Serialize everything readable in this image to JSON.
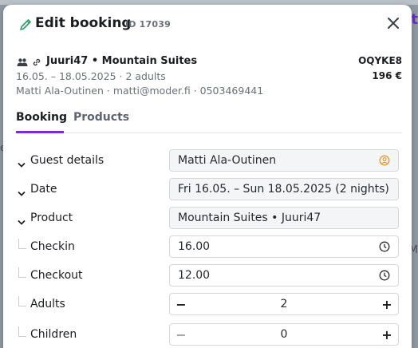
{
  "modal": {
    "title": "Edit booking",
    "id_label": "ID 17039"
  },
  "summary": {
    "title": "Juuri47 • Mountain Suites",
    "code": "OQYKE8",
    "dates": "16.05. – 18.05.2025 · 2 adults",
    "price": "196 €",
    "contact": "Matti Ala-Outinen · matti@moder.fi · 0503469441"
  },
  "tabs": [
    {
      "label": "Booking",
      "active": true
    },
    {
      "label": "Products",
      "active": false
    }
  ],
  "form": {
    "guest": {
      "label": "Guest details",
      "value": "Matti Ala-Outinen"
    },
    "date": {
      "label": "Date",
      "value": "Fri 16.05. – Sun 18.05.2025 (2 nights)"
    },
    "product": {
      "label": "Product",
      "value": "Mountain Suites • Juuri47"
    },
    "checkin": {
      "label": "Checkin",
      "value": "16.00"
    },
    "checkout": {
      "label": "Checkout",
      "value": "12.00"
    },
    "adults": {
      "label": "Adults",
      "value": "2",
      "minus": "−",
      "plus": "+"
    },
    "children": {
      "label": "Children",
      "value": "0",
      "minus": "−",
      "plus": "+"
    }
  },
  "icons": {
    "edit": "pencil-icon",
    "close": "close-icon",
    "people": "people-icon",
    "link": "link-icon",
    "chevron": "chevron-down-icon",
    "user": "user-circle-icon",
    "clock": "clock-icon"
  },
  "colors": {
    "accent": "#7c2bd6",
    "edit_icon": "#2e9a66",
    "user_icon": "#e39a2a"
  }
}
